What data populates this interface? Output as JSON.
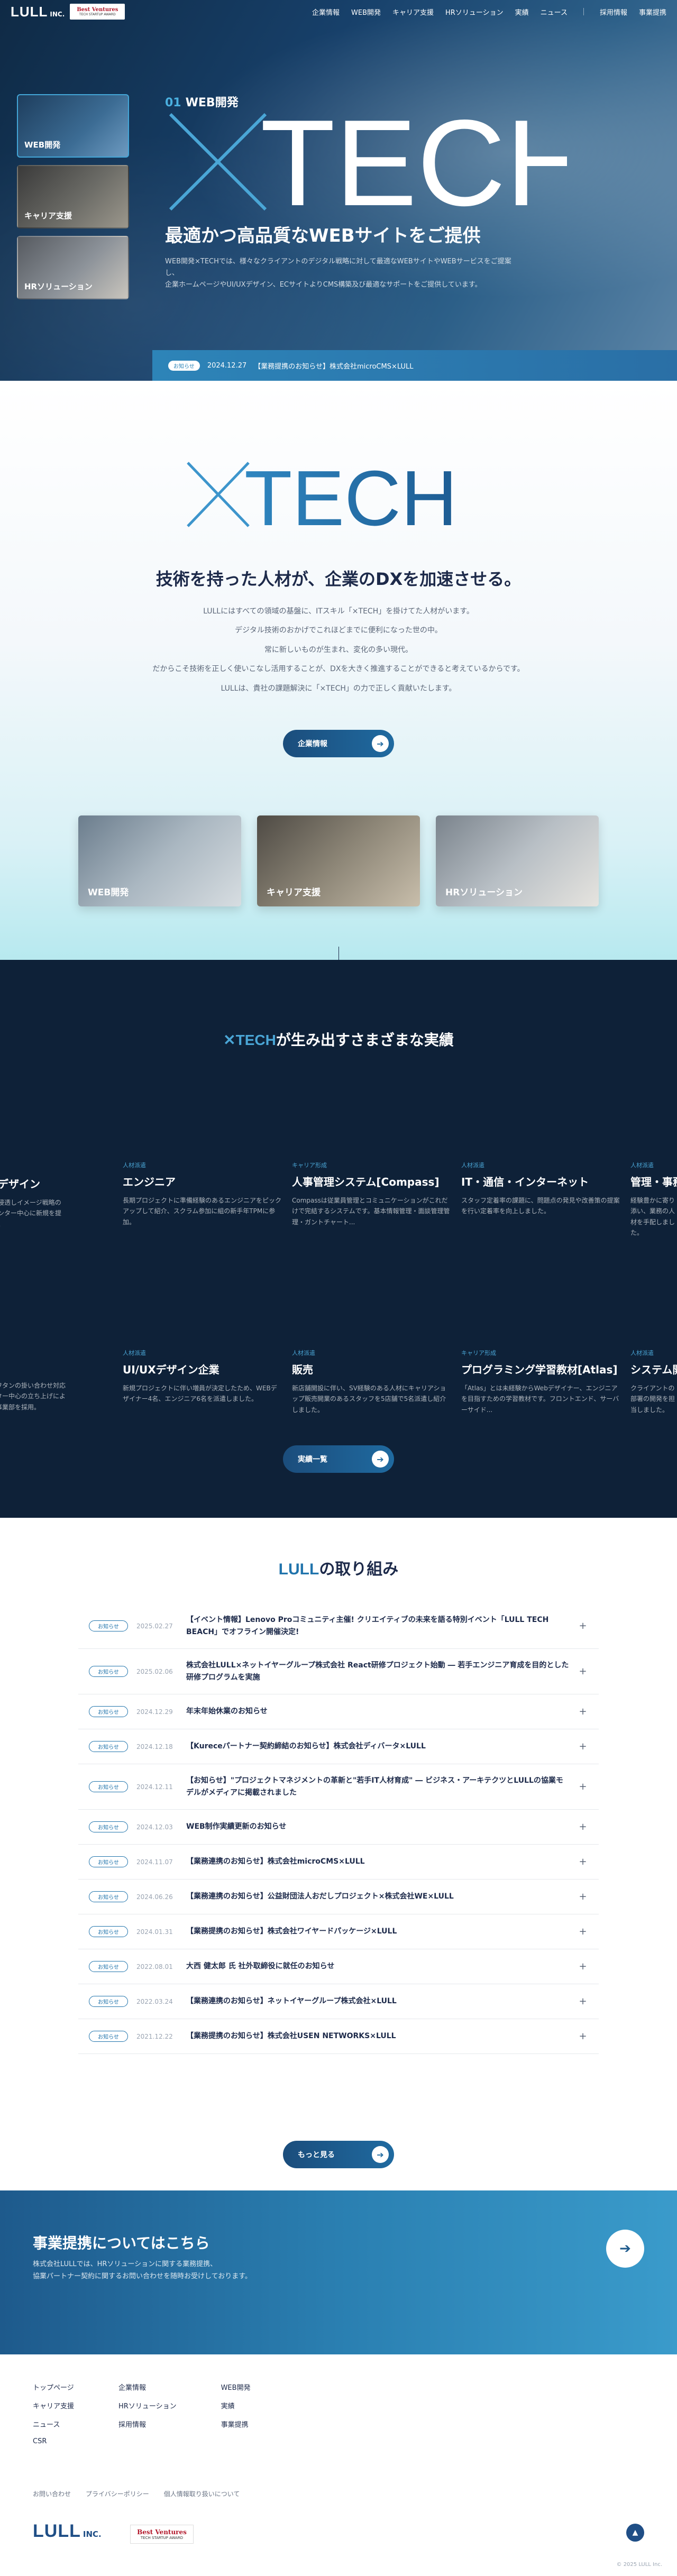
{
  "header": {
    "logo": "LULL",
    "logo_suffix": "INC.",
    "badge_title": "Best Ventures",
    "badge_sub": "TECH STARTUP AWARD",
    "nav": [
      "企業情報",
      "WEB開発",
      "キャリア支援",
      "HRソリューション",
      "実績",
      "ニュース"
    ],
    "nav_right": [
      "採用情報",
      "事業提携"
    ]
  },
  "hero": {
    "tabs": [
      "WEB開発",
      "キャリア支援",
      "HRソリューション"
    ],
    "tag_num": "01",
    "tag_label": "WEB開発",
    "brand_text": "TECH",
    "title": "最適かつ高品質なWEBサイトをご提供",
    "desc_1": "WEB開発×TECHでは、様々なクライアントのデジタル戦略に対して最適なWEBサイトやWEBサービスをご提案し、",
    "desc_2": "企業ホームページやUI/UXデザイン、ECサイトよりCMS構築及び最適なサポートをご提供しています。",
    "news_pill": "お知らせ",
    "news_date": "2024.12.27",
    "news_title": "【業務提携のお知らせ】株式会社microCMS×LULL"
  },
  "intro": {
    "brand_text": "TECH",
    "headline": "技術を持った人材が、企業のDXを加速させる。",
    "body": [
      "LULLにはすべての領域の基盤に、ITスキル「×TECH」を掛けてた人材がいます。",
      "デジタル技術のおかげでこれほどまでに便利になった世の中。",
      "常に新しいものが生まれ、変化の多い現代。",
      "だからこそ技術を正しく使いこなし活用することが、DXを大きく推進することができると考えているからです。",
      "LULLは、貴社の課題解決に「×TECH」の力で正しく貢献いたします。"
    ],
    "button": "企業情報",
    "cards": [
      "WEB開発",
      "キャリア支援",
      "HRソリューション"
    ]
  },
  "works": {
    "heading_brand": "TECH",
    "heading_rest": "が生み出すさまざまな実績",
    "row1": [
      {
        "cat": "",
        "title": "広告・デザイン",
        "desc": "日常生活に浸透しイメージ戦略のスキルをセンター中心に新規を提案しました。"
      },
      {
        "cat": "人材派遣",
        "title": "エンジニア",
        "desc": "長期プロジェクトに準備経験のあるエンジニアをピックアップして紹介、スクラム参加に組の新手年TPMに参加。"
      },
      {
        "cat": "キャリア形成",
        "title": "人事管理システム[Compass]",
        "desc": "Compassは従業員管理とコミュニケーションがこれだけで完結するシステムです。基本情報管理・面談管理管理・ガントチャート..."
      },
      {
        "cat": "人材派遣",
        "title": "IT・通信・インターネット",
        "desc": "スタッフ定着率の課題に、問題点の発見や改善策の提案を行い定着率を向上しました。"
      },
      {
        "cat": "人材派遣",
        "title": "管理・事務",
        "desc": "経験豊かに寄り添い、業務の人材を手配しました。"
      }
    ],
    "row2": [
      {
        "cat": "",
        "title": "",
        "desc": "エスクワタンの掛い合わせ対応をセンター中心の立ち上げにより新規事業部を採用。"
      },
      {
        "cat": "人材派遣",
        "title": "UI/UXデザイン企業",
        "desc": "新規プロジェクトに伴い増員が決定したため、WEBデザイナー4名、エンジニア6名を派遣しました。"
      },
      {
        "cat": "人材派遣",
        "title": "販売",
        "desc": "新店舗開設に伴い、SV経験のある人材にキャリアショップ販売開業のあるスタッフを5店舗で5名派遣し紹介しました。"
      },
      {
        "cat": "キャリア形成",
        "title": "プログラミング学習教材[Atlas]",
        "desc": "「Atlas」とは未経験からWebデザイナー、エンジニアを目指すための学習教材です。フロントエンド、サーバーサイド..."
      },
      {
        "cat": "人材派遣",
        "title": "システム開",
        "desc": "クライアントの部署の開発を担当しました。"
      }
    ],
    "button": "実績一覧"
  },
  "news": {
    "heading_brand": "LULL",
    "heading_rest": "の取り組み",
    "items": [
      {
        "tag": "お知らせ",
        "date": "2025.02.27",
        "title": "【イベント情報】Lenovo Proコミュニティ主催! クリエイティブの未来を語る特別イベント「LULL TECH BEACH」でオフライン開催決定!"
      },
      {
        "tag": "お知らせ",
        "date": "2025.02.06",
        "title": "株式会社LULL×ネットイヤーグループ株式会社 React研修プロジェクト始動 ― 若手エンジニア育成を目的とした研修プログラムを実施"
      },
      {
        "tag": "お知らせ",
        "date": "2024.12.29",
        "title": "年末年始休業のお知らせ"
      },
      {
        "tag": "お知らせ",
        "date": "2024.12.18",
        "title": "【Kureceパートナー契約締結のお知らせ】株式会社ディバータ×LULL"
      },
      {
        "tag": "お知らせ",
        "date": "2024.12.11",
        "title": "【お知らせ】\"プロジェクトマネジメントの革新と\"若手IT人材育成\" ― ビジネス・アーキテクツとLULLの協業モデルがメディアに掲載されました"
      },
      {
        "tag": "お知らせ",
        "date": "2024.12.03",
        "title": "WEB制作実績更新のお知らせ"
      },
      {
        "tag": "お知らせ",
        "date": "2024.11.07",
        "title": "【業務連携のお知らせ】株式会社microCMS×LULL"
      },
      {
        "tag": "お知らせ",
        "date": "2024.06.26",
        "title": "【業務連携のお知らせ】公益財団法人おだしプロジェクト×株式会社WE×LULL"
      },
      {
        "tag": "お知らせ",
        "date": "2024.01.31",
        "title": "【業務提携のお知らせ】株式会社ワイヤードパッケージ×LULL"
      },
      {
        "tag": "お知らせ",
        "date": "2022.08.01",
        "title": "大西 健太郎 氏 社外取締役に就任のお知らせ"
      },
      {
        "tag": "お知らせ",
        "date": "2022.03.24",
        "title": "【業務連携のお知らせ】ネットイヤーグループ株式会社×LULL"
      },
      {
        "tag": "お知らせ",
        "date": "2021.12.22",
        "title": "【業務提携のお知らせ】株式会社USEN NETWORKS×LULL"
      }
    ],
    "button": "もっと見る"
  },
  "cta": {
    "title": "事業提携についてはこちら",
    "body_1": "株式会社LULLでは、HRソリューションに関する業務提携、",
    "body_2": "協業パートナー契約に関するお問い合わせを随時お受けしております。"
  },
  "footer": {
    "col1": [
      "トップページ",
      "キャリア支援",
      "ニュース",
      "CSR"
    ],
    "col2": [
      "企業情報",
      "HRソリューション",
      "採用情報"
    ],
    "col3": [
      "WEB開発",
      "実績",
      "事業提携"
    ],
    "links": [
      "お問い合わせ",
      "プライバシーポリシー",
      "個人情報取り扱いについて"
    ],
    "logo": "LULL",
    "logo_suffix": "INC.",
    "badge_title": "Best Ventures",
    "badge_sub": "TECH STARTUP AWARD",
    "copyright": "© 2025 LULL Inc."
  },
  "colors": {
    "brand_navy": "#1d2a4a",
    "brand_blue": "#2174ac",
    "accent": "#4aa6d6"
  }
}
